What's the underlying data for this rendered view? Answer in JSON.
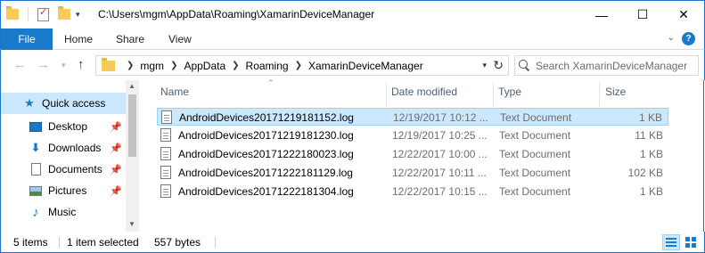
{
  "window": {
    "title_path": "C:\\Users\\mgm\\AppData\\Roaming\\XamarinDeviceManager",
    "controls": {
      "minimize": "—",
      "maximize": "☐",
      "close": "✕"
    }
  },
  "ribbon": {
    "tabs": [
      {
        "label": "File"
      },
      {
        "label": "Home"
      },
      {
        "label": "Share"
      },
      {
        "label": "View"
      }
    ],
    "expand_icon": "chevron-down-icon",
    "help_label": "?"
  },
  "address": {
    "breadcrumbs": [
      "mgm",
      "AppData",
      "Roaming",
      "XamarinDeviceManager"
    ]
  },
  "search": {
    "placeholder": "Search XamarinDeviceManager"
  },
  "sidebar": {
    "items": [
      {
        "label": "Quick access",
        "icon": "star-icon",
        "pinned": false,
        "selected": true
      },
      {
        "label": "Desktop",
        "icon": "desktop-icon",
        "pinned": true
      },
      {
        "label": "Downloads",
        "icon": "download-icon",
        "pinned": true
      },
      {
        "label": "Documents",
        "icon": "documents-icon",
        "pinned": true
      },
      {
        "label": "Pictures",
        "icon": "pictures-icon",
        "pinned": true
      },
      {
        "label": "Music",
        "icon": "music-icon",
        "pinned": false
      }
    ]
  },
  "filelist": {
    "columns": {
      "name": "Name",
      "date": "Date modified",
      "type": "Type",
      "size": "Size"
    },
    "rows": [
      {
        "name": "AndroidDevices20171219181152.log",
        "date": "12/19/2017 10:12 ...",
        "type": "Text Document",
        "size": "1 KB",
        "selected": true
      },
      {
        "name": "AndroidDevices20171219181230.log",
        "date": "12/19/2017 10:25 ...",
        "type": "Text Document",
        "size": "11 KB"
      },
      {
        "name": "AndroidDevices20171222180023.log",
        "date": "12/22/2017 10:00 ...",
        "type": "Text Document",
        "size": "1 KB"
      },
      {
        "name": "AndroidDevices20171222181129.log",
        "date": "12/22/2017 10:11 ...",
        "type": "Text Document",
        "size": "102 KB"
      },
      {
        "name": "AndroidDevices20171222181304.log",
        "date": "12/22/2017 10:15 ...",
        "type": "Text Document",
        "size": "1 KB"
      }
    ]
  },
  "status": {
    "item_count": "5 items",
    "selection": "1 item selected",
    "selection_size": "557 bytes"
  },
  "colors": {
    "accent": "#1979ca",
    "selection": "#cce8ff",
    "selection_border": "#99d1ff",
    "window_border": "#1a73c8"
  }
}
